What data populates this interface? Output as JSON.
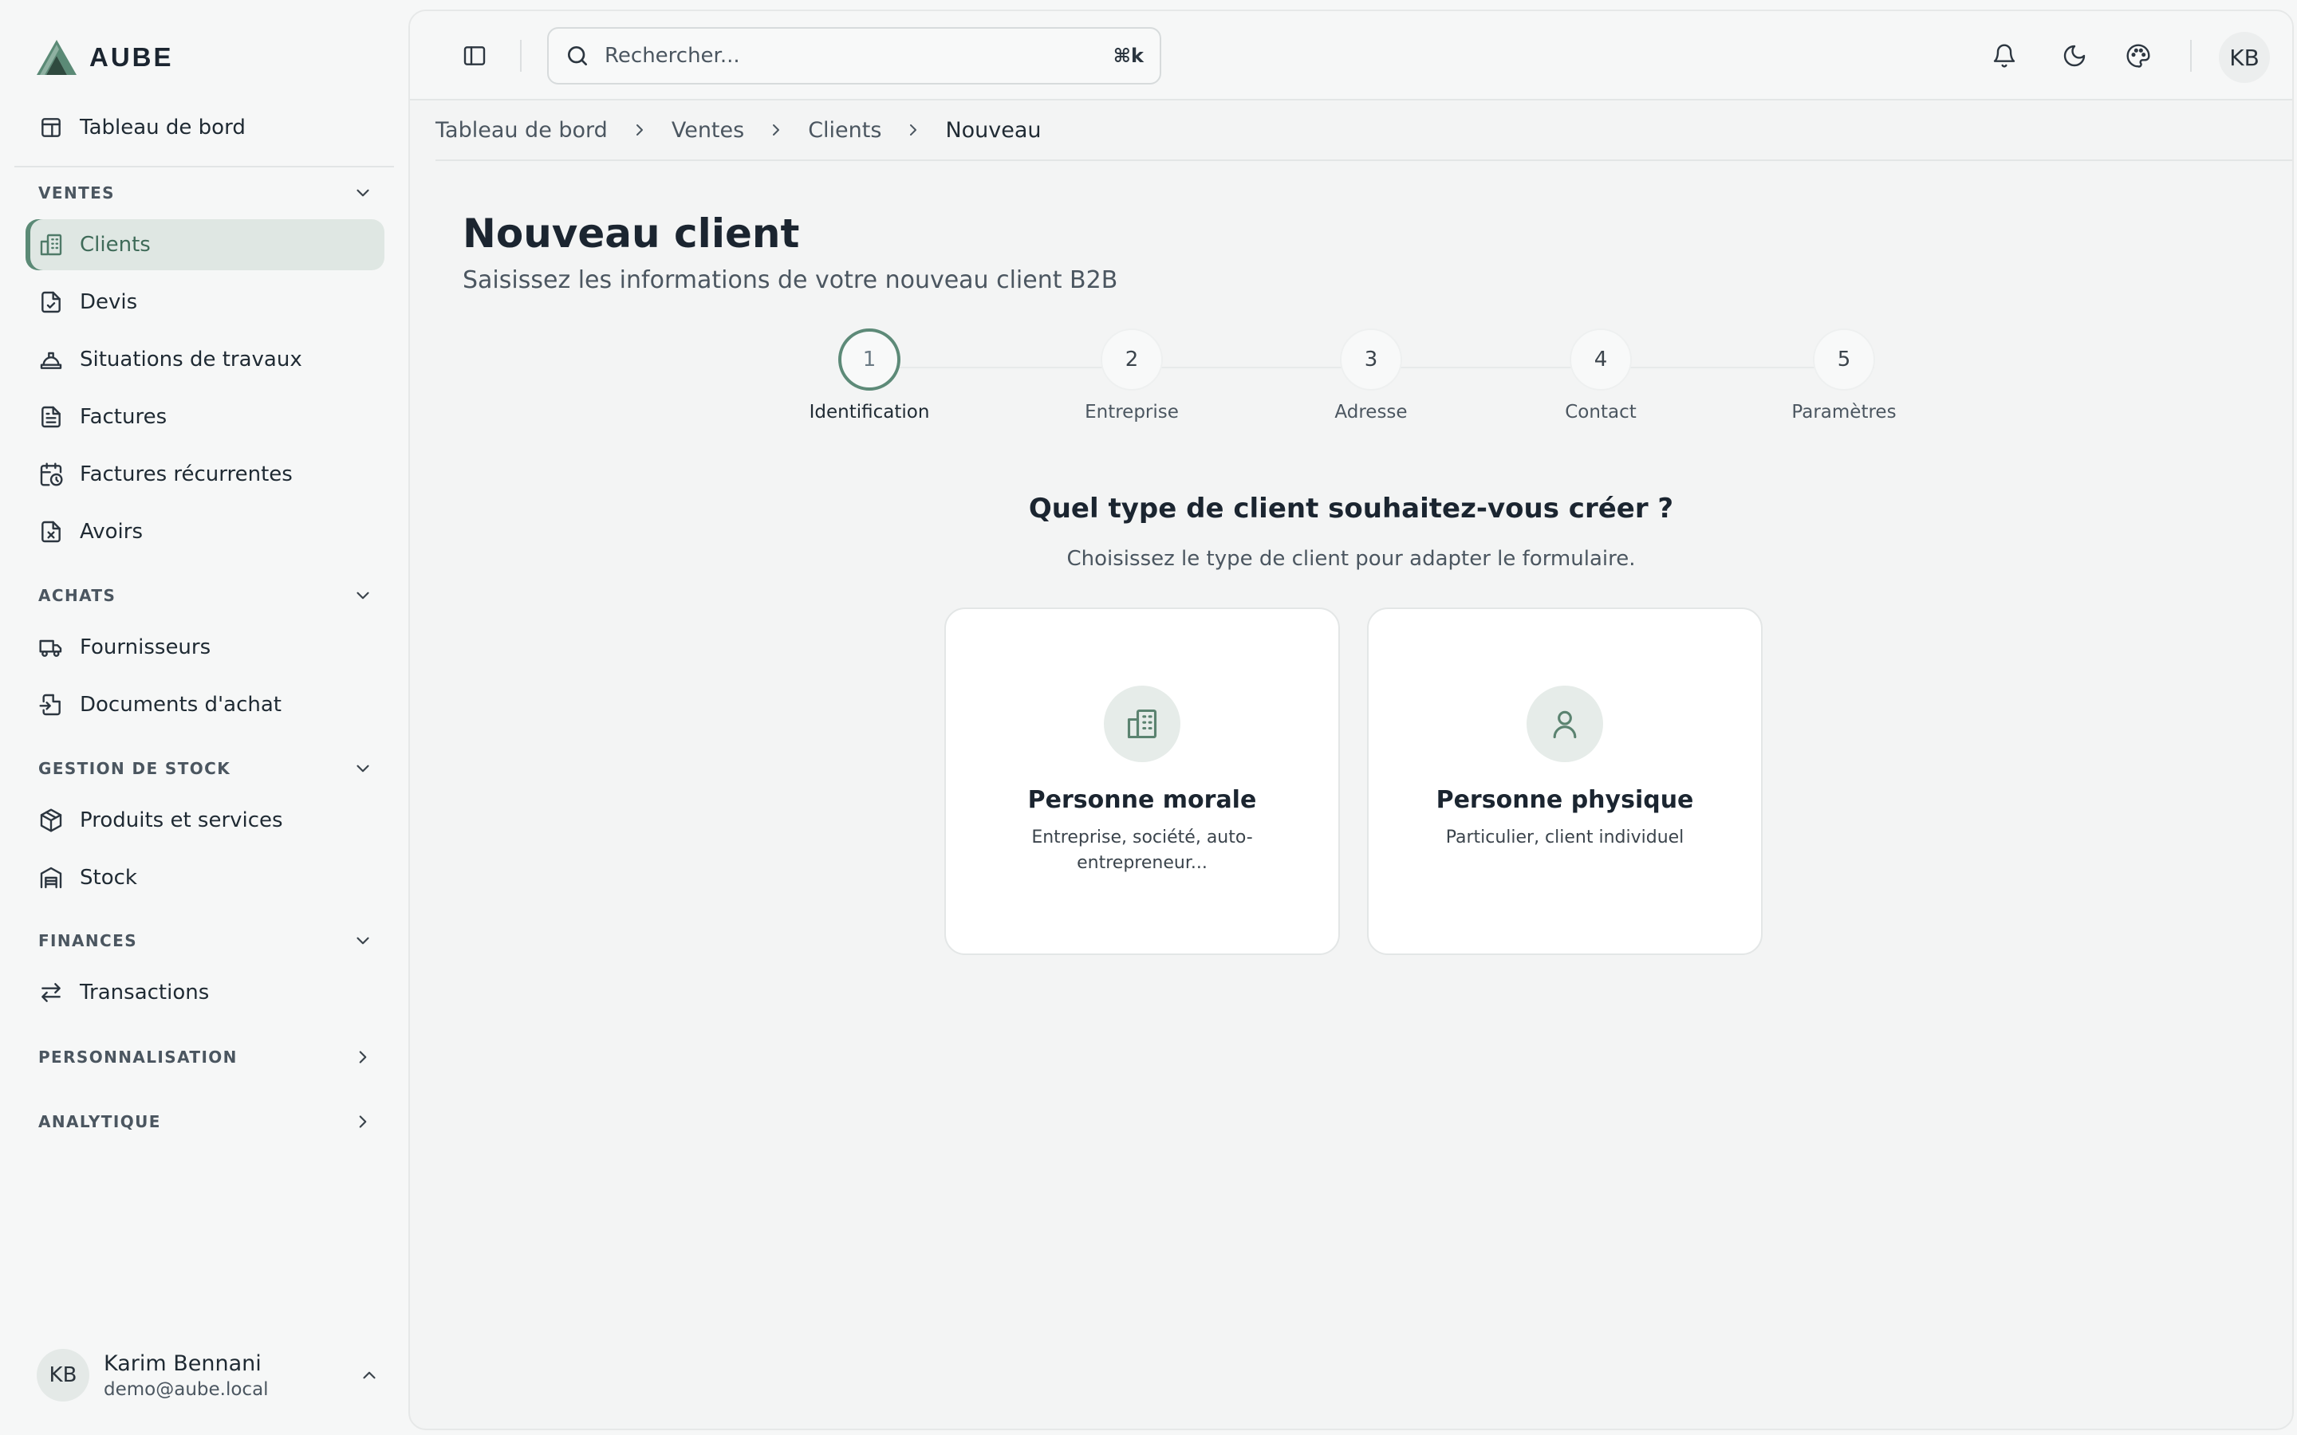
{
  "app": {
    "brand": "AUBE"
  },
  "sidebar": {
    "dashboard_label": "Tableau de bord",
    "groups": {
      "ventes": "VENTES",
      "achats": "ACHATS",
      "stock": "GESTION DE STOCK",
      "finances": "FINANCES",
      "perso": "PERSONNALISATION",
      "analytique": "ANALYTIQUE"
    },
    "items": {
      "clients": "Clients",
      "devis": "Devis",
      "situations": "Situations de travaux",
      "factures": "Factures",
      "factures_rec": "Factures récurrentes",
      "avoirs": "Avoirs",
      "fournisseurs": "Fournisseurs",
      "docs_achat": "Documents d'achat",
      "produits": "Produits et services",
      "stock": "Stock",
      "transactions": "Transactions"
    },
    "active_item": "Clients",
    "user": {
      "initials": "KB",
      "name": "Karim Bennani",
      "email": "demo@aube.local"
    }
  },
  "topbar": {
    "search_placeholder": "Rechercher...",
    "search_shortcut": "⌘k",
    "avatar_initials": "KB"
  },
  "breadcrumb": [
    "Tableau de bord",
    "Ventes",
    "Clients",
    "Nouveau"
  ],
  "page": {
    "title": "Nouveau client",
    "subtitle": "Saisissez les informations de votre nouveau client B2B"
  },
  "stepper": {
    "active_step": 1,
    "steps": [
      {
        "number": "1",
        "label": "Identification"
      },
      {
        "number": "2",
        "label": "Entreprise"
      },
      {
        "number": "3",
        "label": "Adresse"
      },
      {
        "number": "4",
        "label": "Contact"
      },
      {
        "number": "5",
        "label": "Paramètres"
      }
    ]
  },
  "client_type": {
    "question": "Quel type de client souhaitez-vous créer ?",
    "hint": "Choisissez le type de client pour adapter le formulaire.",
    "options": [
      {
        "icon": "building-icon",
        "title": "Personne morale",
        "description": "Entreprise, société, auto-entrepreneur..."
      },
      {
        "icon": "user-icon",
        "title": "Personne physique",
        "description": "Particulier, client individuel"
      }
    ]
  },
  "colors": {
    "accent": "#5b8a76",
    "active_bg": "#dfe7e3",
    "page_bg": "#f3f4f4",
    "card_bg": "#ffffff"
  }
}
